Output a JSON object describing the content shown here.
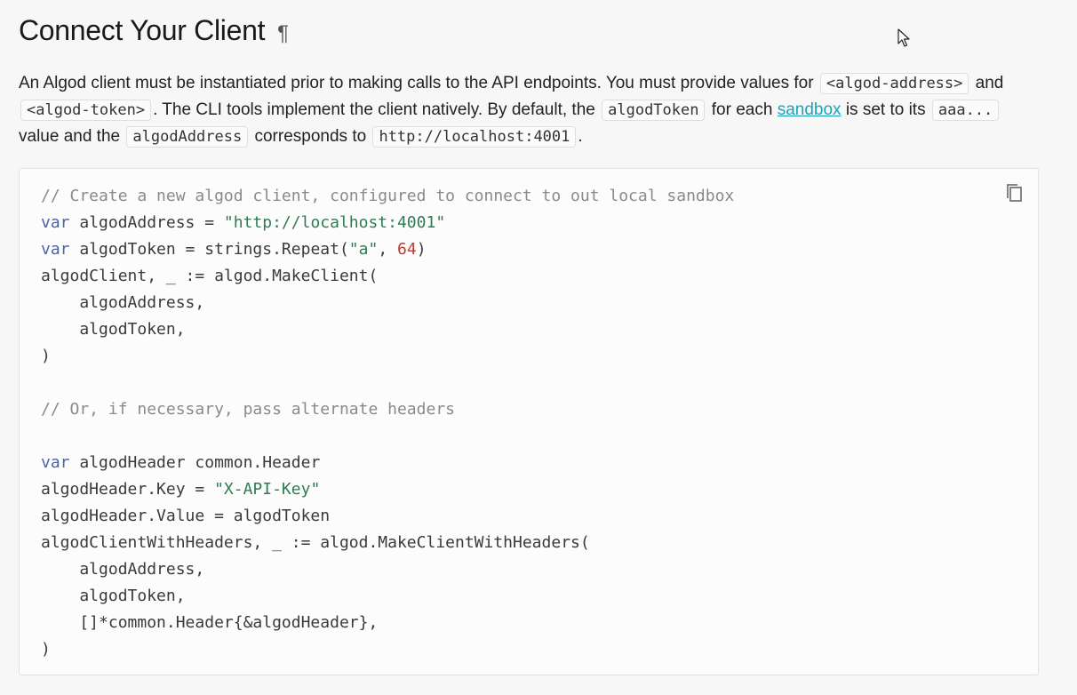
{
  "heading": {
    "title": "Connect Your Client",
    "anchor": "¶"
  },
  "intro": {
    "t1": "An Algod client must be instantiated prior to making calls to the API endpoints. You must provide values for ",
    "c1": "<algod-address>",
    "t2": " and ",
    "c2": "<algod-token>",
    "t3": ". The CLI tools implement the client natively. By default, the ",
    "c3": "algodToken",
    "t4": " for each ",
    "link": "sandbox",
    "t5": " is set to its ",
    "c4": "aaa...",
    "t6": " value and the ",
    "c5": "algodAddress",
    "t7": " corresponds to ",
    "c6": "http://localhost:4001",
    "t8": "."
  },
  "code_block": {
    "copy_icon": "copy-icon",
    "lines": [
      [
        {
          "t": "// Create a new algod client, configured to connect to out local sandbox",
          "c": "cm"
        }
      ],
      [
        {
          "t": "var",
          "c": "kw"
        },
        {
          "t": " algodAddress = "
        },
        {
          "t": "\"http://localhost:4001\"",
          "c": "str"
        }
      ],
      [
        {
          "t": "var",
          "c": "kw"
        },
        {
          "t": " algodToken = strings.Repeat("
        },
        {
          "t": "\"a\"",
          "c": "str"
        },
        {
          "t": ", "
        },
        {
          "t": "64",
          "c": "num"
        },
        {
          "t": ")"
        }
      ],
      [
        {
          "t": "algodClient, _ := algod.MakeClient("
        }
      ],
      [
        {
          "t": "    algodAddress,"
        }
      ],
      [
        {
          "t": "    algodToken,"
        }
      ],
      [
        {
          "t": ")"
        }
      ],
      [
        {
          "t": ""
        }
      ],
      [
        {
          "t": "// Or, if necessary, pass alternate headers",
          "c": "cm"
        }
      ],
      [
        {
          "t": ""
        }
      ],
      [
        {
          "t": "var",
          "c": "kw"
        },
        {
          "t": " algodHeader common.Header"
        }
      ],
      [
        {
          "t": "algodHeader.Key = "
        },
        {
          "t": "\"X-API-Key\"",
          "c": "str"
        }
      ],
      [
        {
          "t": "algodHeader.Value = algodToken"
        }
      ],
      [
        {
          "t": "algodClientWithHeaders, _ := algod.MakeClientWithHeaders("
        }
      ],
      [
        {
          "t": "    algodAddress,"
        }
      ],
      [
        {
          "t": "    algodToken,"
        }
      ],
      [
        {
          "t": "    []*common.Header{&algodHeader},"
        }
      ],
      [
        {
          "t": ")"
        }
      ]
    ]
  },
  "cursor_icon": "mouse-pointer-icon"
}
